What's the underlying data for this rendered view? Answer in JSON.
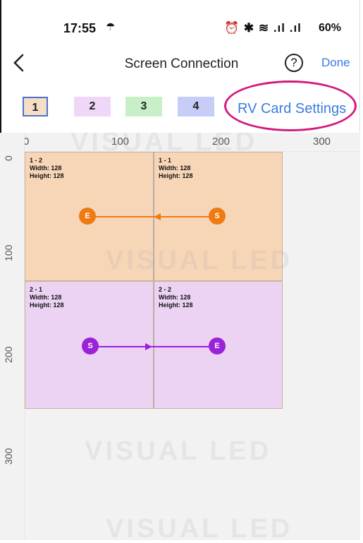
{
  "status_bar": {
    "time": "17:55",
    "right_icons": "⏰ ✱ ≋ .ıl .ıl",
    "battery": "60%"
  },
  "header": {
    "title": "Screen Connection",
    "help_symbol": "?",
    "done_label": "Done"
  },
  "card_tabs": [
    "1",
    "2",
    "3",
    "4"
  ],
  "rv_card_settings_label": "RV Card Settings",
  "canvas": {
    "x_ticks": [
      "0",
      "100",
      "200",
      "300"
    ],
    "y_ticks": [
      "0",
      "100",
      "200",
      "300"
    ],
    "watermark": "VISUAL LED",
    "panels": [
      {
        "label_line1": "1 - 2",
        "label_line2": "Width: 128",
        "label_line3": "Height: 128",
        "fill": "#f7d6b8"
      },
      {
        "label_line1": "1 - 1",
        "label_line2": "Width: 128",
        "label_line3": "Height: 128",
        "fill": "#f7d6b8"
      },
      {
        "label_line1": "2 - 1",
        "label_line2": "Width: 128",
        "label_line3": "Height: 128",
        "fill": "#ecd3f4"
      },
      {
        "label_line1": "2 - 2",
        "label_line2": "Width: 128",
        "label_line3": "Height: 128",
        "fill": "#ecd3f4"
      }
    ],
    "connections": [
      {
        "start": "S",
        "end": "E",
        "color": "#f07a12"
      },
      {
        "start": "S",
        "end": "E",
        "color": "#9a22d8"
      }
    ]
  },
  "colors": {
    "accent_blue": "#3a7be0",
    "highlight": "#d4197d"
  }
}
